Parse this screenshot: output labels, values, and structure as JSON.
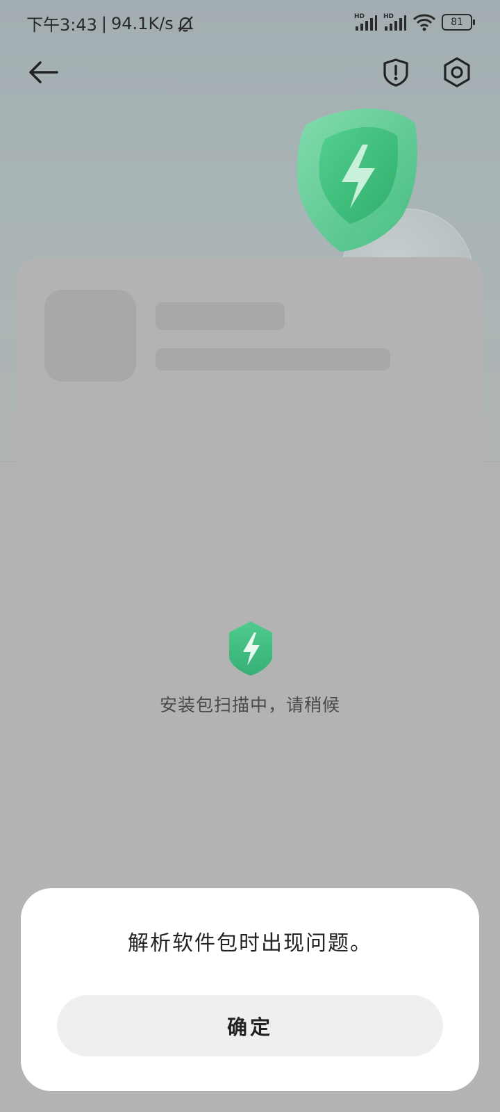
{
  "status_bar": {
    "time": "下午3:43",
    "separator": "|",
    "net_speed": "94.1K/s",
    "mute_icon": "bell-off-icon",
    "signal1_label": "HD",
    "signal2_label": "HD",
    "wifi_icon": "wifi-icon",
    "battery": "81"
  },
  "nav": {
    "back_icon": "arrow-left-icon",
    "shield_icon": "shield-alert-icon",
    "settings_icon": "settings-hexagon-icon"
  },
  "scanning": {
    "icon": "green-shield-bolt-icon",
    "text": "安装包扫描中，请稍候"
  },
  "dialog": {
    "message": "解析软件包时出现问题。",
    "confirm_label": "确定"
  },
  "colors": {
    "accent_green": "#3fbf85",
    "dialog_bg": "#ffffff",
    "button_bg": "#efefef",
    "scrim": "#b3b3b3"
  }
}
